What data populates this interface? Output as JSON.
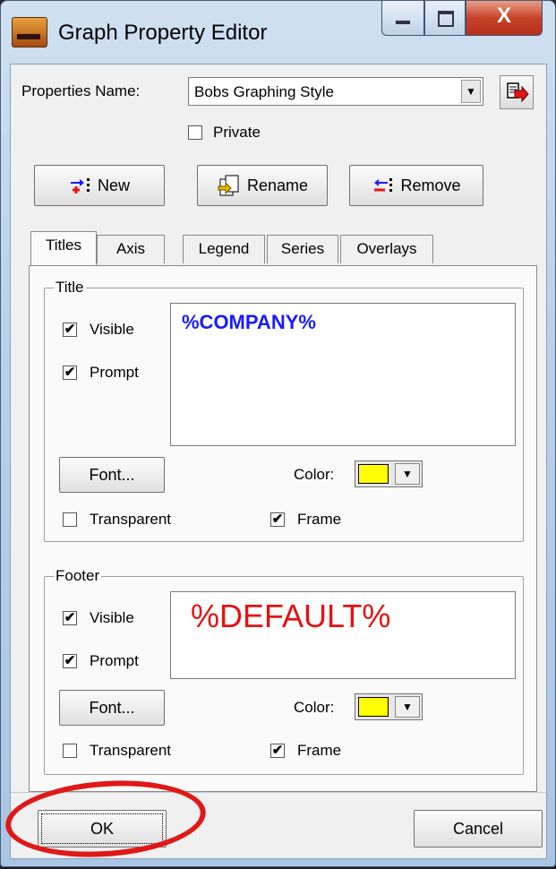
{
  "window": {
    "title": "Graph Property Editor",
    "icon": "app-icon",
    "close_glyph": "X"
  },
  "properties": {
    "name_label": "Properties Name:",
    "name_value": "Bobs Graphing Style",
    "private_label": "Private",
    "private_checked": false
  },
  "actions": {
    "new_label": "New",
    "rename_label": "Rename",
    "remove_label": "Remove"
  },
  "tabs": [
    {
      "label": "Titles",
      "active": true
    },
    {
      "label": "Axis",
      "active": false
    },
    {
      "label": "Legend",
      "active": false
    },
    {
      "label": "Series",
      "active": false
    },
    {
      "label": "Overlays",
      "active": false
    }
  ],
  "title_group": {
    "label": "Title",
    "visible_label": "Visible",
    "visible_checked": true,
    "prompt_label": "Prompt",
    "prompt_checked": true,
    "text": "%COMPANY%",
    "text_color": "#1a1aff",
    "font_button": "Font...",
    "color_label": "Color:",
    "color_value": "#ffff00",
    "transparent_label": "Transparent",
    "transparent_checked": false,
    "frame_label": "Frame",
    "frame_checked": true
  },
  "footer_group": {
    "label": "Footer",
    "visible_label": "Visible",
    "visible_checked": true,
    "prompt_label": "Prompt",
    "prompt_checked": true,
    "text": "%DEFAULT%",
    "text_color": "#e81010",
    "font_button": "Font...",
    "color_label": "Color:",
    "color_value": "#ffff00",
    "transparent_label": "Transparent",
    "transparent_checked": false,
    "frame_label": "Frame",
    "frame_checked": true
  },
  "footer_buttons": {
    "ok_label": "OK",
    "cancel_label": "Cancel"
  },
  "check_glyph": "✔"
}
